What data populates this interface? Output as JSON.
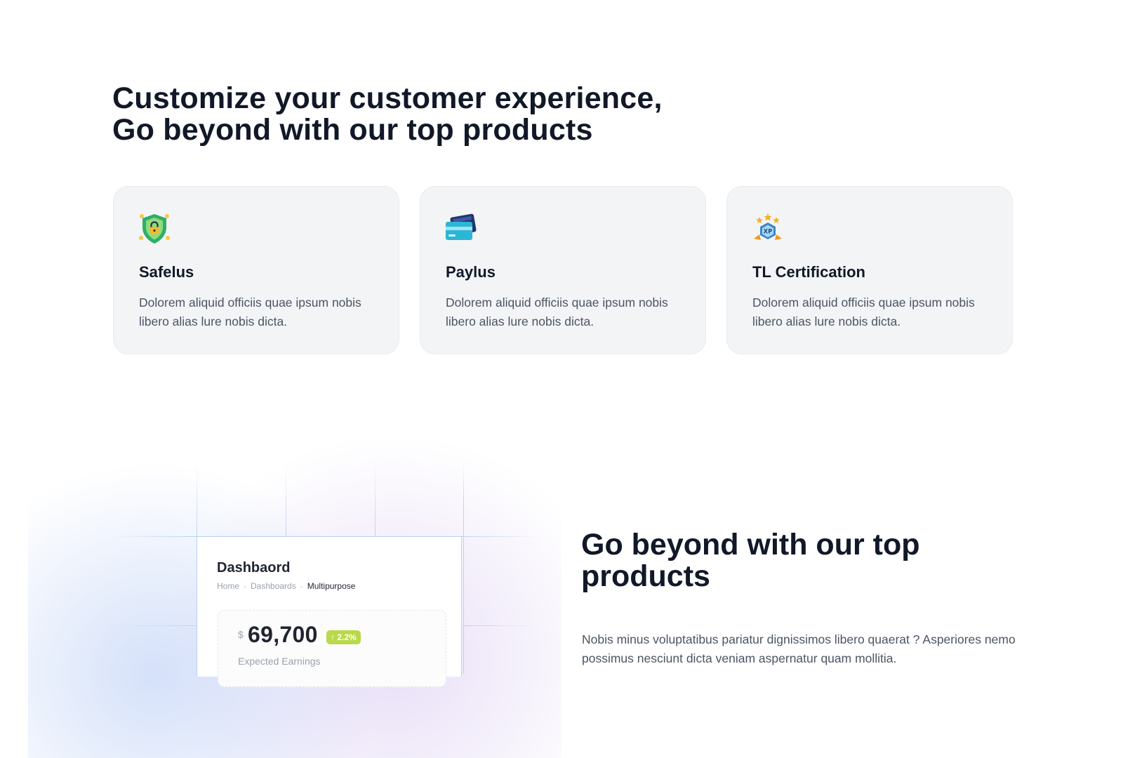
{
  "headline": "Customize your customer experience, Go beyond with our top products",
  "features": [
    {
      "icon": "shield-lock-icon",
      "title": "Safelus",
      "description": "Dolorem aliquid officiis quae ipsum nobis libero alias lure nobis dicta."
    },
    {
      "icon": "credit-card-icon",
      "title": "Paylus",
      "description": "Dolorem aliquid officiis quae ipsum nobis libero alias lure nobis dicta."
    },
    {
      "icon": "xp-badge-icon",
      "title": "TL Certification",
      "description": "Dolorem aliquid officiis quae ipsum nobis libero alias lure nobis dicta."
    }
  ],
  "dashboard": {
    "title": "Dashbaord",
    "breadcrumb": [
      "Home",
      "Dashboards",
      "Multipurpose"
    ],
    "earnings": {
      "currency": "$",
      "value": "69,700",
      "change": "↑ 2.2%",
      "label": "Expected Earnings"
    }
  },
  "section2": {
    "title": "Go beyond with our top products",
    "text": "Nobis minus voluptatibus pariatur dignissimos libero quaerat ? Asperiores nemo possimus nesciunt dicta veniam aspernatur quam mollitia."
  },
  "colors": {
    "heading": "#111827",
    "body_text": "#4b5563",
    "card_bg": "#f3f4f6",
    "badge_green": "#b9d94a",
    "grid_blue": "#bcd3f2"
  }
}
